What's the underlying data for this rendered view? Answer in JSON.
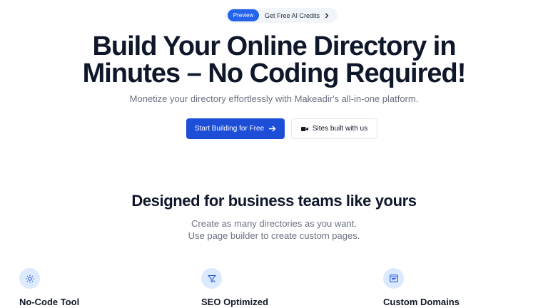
{
  "announcement": {
    "badge_label": "Preview",
    "text": "Get Free AI Credits",
    "icon": "chevron-right-icon"
  },
  "hero": {
    "headline_line1": "Build Your Online Directory in",
    "headline_line2": "Minutes – No Coding Required!",
    "subheadline": "Monetize your directory effortlessly with Makeadir's all-in-one platform.",
    "primary_button": "Start Building for Free",
    "primary_icon": "arrow-right-icon",
    "secondary_button": "Sites built with us",
    "secondary_icon": "video-icon"
  },
  "section": {
    "heading": "Designed for business teams like yours",
    "line1": "Create as many directories as you want.",
    "line2": "Use page builder to create custom pages."
  },
  "features": [
    {
      "title": "No-Code Tool",
      "icon": "sun-icon"
    },
    {
      "title": "SEO Optimized",
      "icon": "funnel-icon"
    },
    {
      "title": "Custom Domains",
      "icon": "browser-icon"
    }
  ],
  "colors": {
    "accent": "#1d4ed8",
    "badge": "#2563eb",
    "icon_bg": "#dbeafe",
    "text_dark": "#0f172a",
    "text_muted": "#6b7280"
  }
}
